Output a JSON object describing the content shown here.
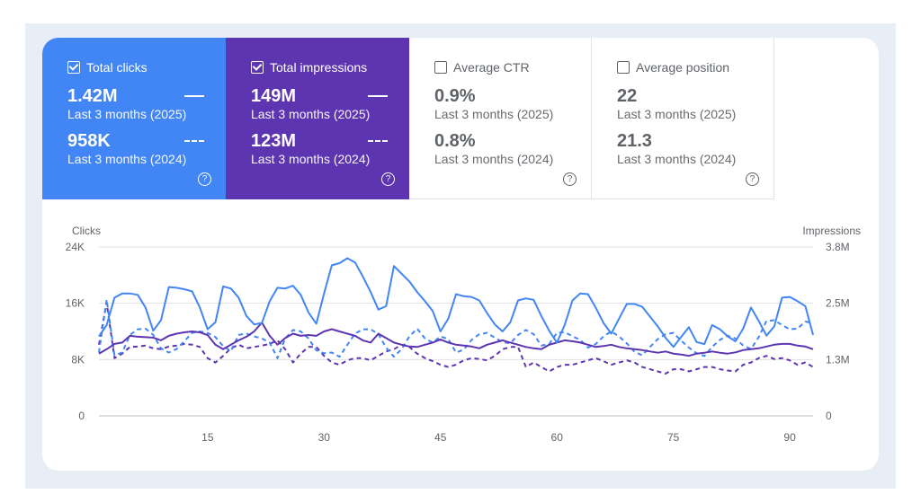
{
  "metrics": [
    {
      "label": "Total clicks",
      "checked": true,
      "value1": "1.42M",
      "period1": "Last 3 months (2025)",
      "value2": "958K",
      "period2": "Last 3 months (2024)",
      "help": "?"
    },
    {
      "label": "Total impressions",
      "checked": true,
      "value1": "149M",
      "period1": "Last 3 months (2025)",
      "value2": "123M",
      "period2": "Last 3 months (2024)",
      "help": "?"
    },
    {
      "label": "Average CTR",
      "checked": false,
      "value1": "0.9%",
      "period1": "Last 3 months (2025)",
      "value2": "0.8%",
      "period2": "Last 3 months (2024)",
      "help": "?"
    },
    {
      "label": "Average position",
      "checked": false,
      "value1": "22",
      "period1": "Last 3 months (2025)",
      "value2": "21.3",
      "period2": "Last 3 months (2024)",
      "help": "?"
    }
  ],
  "colors": {
    "clicks": "#4285f4",
    "impressions": "#5e35b1",
    "grid": "#e0e0e0",
    "axis": "#5f6368"
  },
  "chart_data": {
    "type": "line",
    "ylabel_left": "Clicks",
    "ylabel_right": "Impressions",
    "left_ticks": [
      "0",
      "8K",
      "16K",
      "24K"
    ],
    "right_ticks": [
      "0",
      "1.3M",
      "2.5M",
      "3.8M"
    ],
    "ylim_left": [
      0,
      24000
    ],
    "ylim_right": [
      0,
      3800000
    ],
    "x_ticks": [
      15,
      30,
      45,
      60,
      75,
      90
    ],
    "xlim": [
      1,
      93
    ],
    "grid": true,
    "series": [
      {
        "name": "Total clicks",
        "period": "Last 3 months (2025)",
        "style": "solid",
        "axis": "left",
        "values": [
          11300,
          12900,
          16800,
          17400,
          17400,
          17200,
          15400,
          12100,
          13600,
          18300,
          18200,
          18000,
          17700,
          15400,
          12300,
          13300,
          18400,
          18100,
          16800,
          14200,
          13000,
          13200,
          16300,
          18200,
          18100,
          18500,
          17200,
          14700,
          13100,
          17400,
          21400,
          21700,
          22400,
          21800,
          19800,
          17600,
          15100,
          15600,
          21300,
          20200,
          19100,
          17600,
          16300,
          14900,
          12000,
          13800,
          17300,
          17000,
          16900,
          16400,
          14600,
          13000,
          12000,
          13300,
          16400,
          16700,
          16500,
          14200,
          12100,
          10400,
          12900,
          16400,
          17400,
          17300,
          15400,
          13200,
          11700,
          13800,
          15900,
          15900,
          15500,
          14100,
          12700,
          11100,
          9800,
          11200,
          12600,
          10500,
          10200,
          12900,
          12300,
          11300,
          10600,
          12400,
          15400,
          13500,
          11400,
          12700,
          16800,
          16900,
          16300,
          15600,
          11500
        ]
      },
      {
        "name": "Total clicks",
        "period": "Last 3 months (2024)",
        "style": "dashed",
        "axis": "left",
        "values": [
          9000,
          16500,
          8600,
          9000,
          11500,
          12300,
          12400,
          11500,
          9600,
          9000,
          9500,
          10600,
          11800,
          12000,
          11800,
          11200,
          9900,
          9200,
          11500,
          11700,
          11300,
          11000,
          10400,
          8200,
          11000,
          12200,
          12000,
          11000,
          9300,
          8900,
          9000,
          8400,
          10100,
          11700,
          12300,
          12300,
          11600,
          9700,
          8400,
          9500,
          11300,
          12400,
          11000,
          10400,
          11300,
          10900,
          9000,
          9400,
          10800,
          11600,
          11800,
          11100,
          10500,
          10300,
          11500,
          12200,
          11600,
          10000,
          10200,
          11800,
          11900,
          11300,
          10800,
          9700,
          10200,
          11300,
          12000,
          11300,
          10300,
          9100,
          8600,
          9800,
          10900,
          11600,
          11800,
          10700,
          9700,
          8900,
          8500,
          9800,
          10800,
          11400,
          11000,
          10000,
          9500,
          11200,
          13500,
          13600,
          12900,
          12300,
          12400,
          13400,
          13200
        ]
      },
      {
        "name": "Total impressions",
        "period": "Last 3 months (2025)",
        "style": "solid",
        "axis": "right",
        "values": [
          1400000,
          1500000,
          1620000,
          1650000,
          1800000,
          1780000,
          1770000,
          1760000,
          1700000,
          1800000,
          1850000,
          1880000,
          1900000,
          1880000,
          1820000,
          1600000,
          1500000,
          1600000,
          1700000,
          1780000,
          1900000,
          2100000,
          1800000,
          1600000,
          1750000,
          1850000,
          1800000,
          1820000,
          1800000,
          1900000,
          1950000,
          1900000,
          1850000,
          1800000,
          1700000,
          1650000,
          1850000,
          1750000,
          1650000,
          1600000,
          1560000,
          1550000,
          1600000,
          1650000,
          1720000,
          1650000,
          1600000,
          1580000,
          1560000,
          1520000,
          1600000,
          1650000,
          1700000,
          1650000,
          1600000,
          1550000,
          1520000,
          1500000,
          1600000,
          1650000,
          1700000,
          1680000,
          1650000,
          1600000,
          1550000,
          1570000,
          1600000,
          1550000,
          1520000,
          1500000,
          1480000,
          1450000,
          1420000,
          1450000,
          1400000,
          1380000,
          1350000,
          1400000,
          1420000,
          1450000,
          1420000,
          1400000,
          1430000,
          1480000,
          1500000,
          1520000,
          1560000,
          1600000,
          1620000,
          1620000,
          1580000,
          1560000,
          1500000
        ]
      },
      {
        "name": "Total impressions",
        "period": "Last 3 months (2024)",
        "style": "dashed",
        "axis": "right",
        "values": [
          1600000,
          2550000,
          1300000,
          1400000,
          1550000,
          1560000,
          1580000,
          1520000,
          1500000,
          1560000,
          1580000,
          1620000,
          1600000,
          1550000,
          1300000,
          1200000,
          1350000,
          1520000,
          1600000,
          1520000,
          1550000,
          1580000,
          1620000,
          1700000,
          1500000,
          1200000,
          1400000,
          1550000,
          1550000,
          1350000,
          1200000,
          1150000,
          1250000,
          1300000,
          1300000,
          1250000,
          1350000,
          1450000,
          1500000,
          1600000,
          1550000,
          1400000,
          1300000,
          1230000,
          1150000,
          1100000,
          1150000,
          1250000,
          1300000,
          1280000,
          1250000,
          1350000,
          1500000,
          1550000,
          1550000,
          1100000,
          1200000,
          1100000,
          1000000,
          1100000,
          1150000,
          1150000,
          1200000,
          1250000,
          1300000,
          1230000,
          1150000,
          1200000,
          1250000,
          1200000,
          1100000,
          1050000,
          1000000,
          950000,
          1050000,
          1050000,
          1000000,
          1050000,
          1100000,
          1100000,
          1050000,
          1020000,
          1000000,
          1150000,
          1200000,
          1300000,
          1350000,
          1280000,
          1300000,
          1250000,
          1150000,
          1200000,
          1100000
        ]
      }
    ]
  }
}
